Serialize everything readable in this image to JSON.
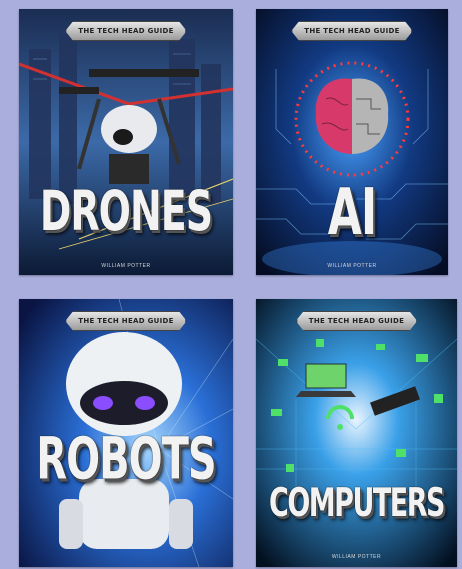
{
  "colors": {
    "page_background": "#aaaedd"
  },
  "books": [
    {
      "series": "THE TECH HEAD GUIDE",
      "title": "DRONES",
      "author": "WILLIAM POTTER",
      "palette": [
        "#0b1a38",
        "#2f6fb8",
        "#c22a2a"
      ]
    },
    {
      "series": "THE TECH HEAD GUIDE",
      "title": "AI",
      "author": "WILLIAM POTTER",
      "palette": [
        "#06122e",
        "#1a6fd0",
        "#e03050"
      ]
    },
    {
      "series": "THE TECH HEAD GUIDE",
      "title": "ROBOTS",
      "author": "",
      "palette": [
        "#0a1a4a",
        "#2b7ce8",
        "#7a3cf0"
      ]
    },
    {
      "series": "THE TECH HEAD GUIDE",
      "title": "COMPUTERS",
      "author": "WILLIAM POTTER",
      "palette": [
        "#041220",
        "#1a8fd8",
        "#4fe06a"
      ]
    }
  ]
}
